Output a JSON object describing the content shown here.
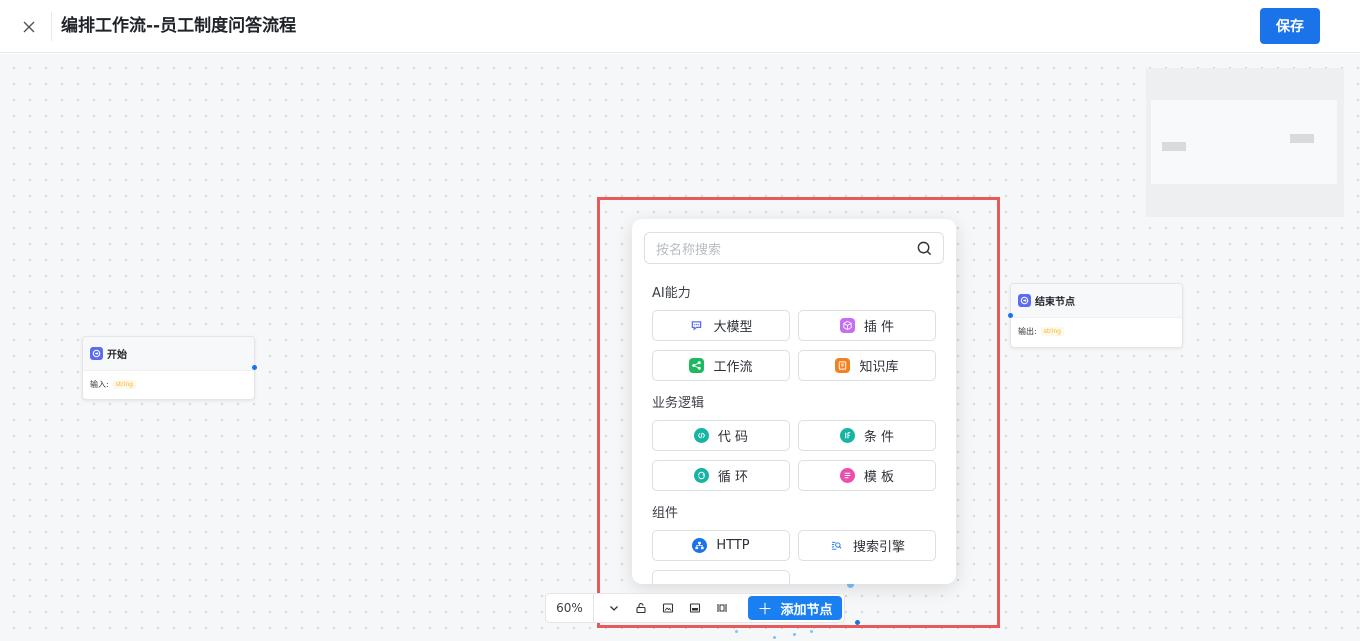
{
  "header": {
    "title": "编排工作流--员工制度问答流程",
    "save_label": "保存"
  },
  "nodes": {
    "start": {
      "title": "开始",
      "field_label": "输入:",
      "field_type": "string"
    },
    "end": {
      "title": "结束节点",
      "field_label": "输出:",
      "field_type": "string"
    }
  },
  "picker": {
    "search_placeholder": "按名称搜索",
    "groups": [
      {
        "title": "AI能力",
        "items": [
          {
            "label": "大模型",
            "icon": "chat-bubble-icon",
            "color": "#ffffff"
          },
          {
            "label": "插 件",
            "icon": "cube-icon",
            "color": "#c56ef2"
          },
          {
            "label": "工作流",
            "icon": "flow-icon",
            "color": "#1fb862"
          },
          {
            "label": "知识库",
            "icon": "book-icon",
            "color": "#f2821f"
          }
        ]
      },
      {
        "title": "业务逻辑",
        "items": [
          {
            "label": "代 码",
            "icon": "code-icon",
            "color": "#16b5a3"
          },
          {
            "label": "条 件",
            "icon": "if-icon",
            "color": "#16b5a3"
          },
          {
            "label": "循 环",
            "icon": "loop-icon",
            "color": "#16b5a3"
          },
          {
            "label": "模 板",
            "icon": "template-icon",
            "color": "#ea4fb0"
          }
        ]
      },
      {
        "title": "组件",
        "items": [
          {
            "label": "HTTP",
            "icon": "network-icon",
            "color": "#1a73e8"
          },
          {
            "label": "搜索引擎",
            "icon": "search-engine-icon",
            "color": "#ffffff"
          }
        ]
      }
    ]
  },
  "toolbar": {
    "zoom": "60%",
    "add_node_label": "添加节点"
  },
  "colors": {
    "primary": "#1a73e8",
    "highlight": "#e85a5a"
  }
}
